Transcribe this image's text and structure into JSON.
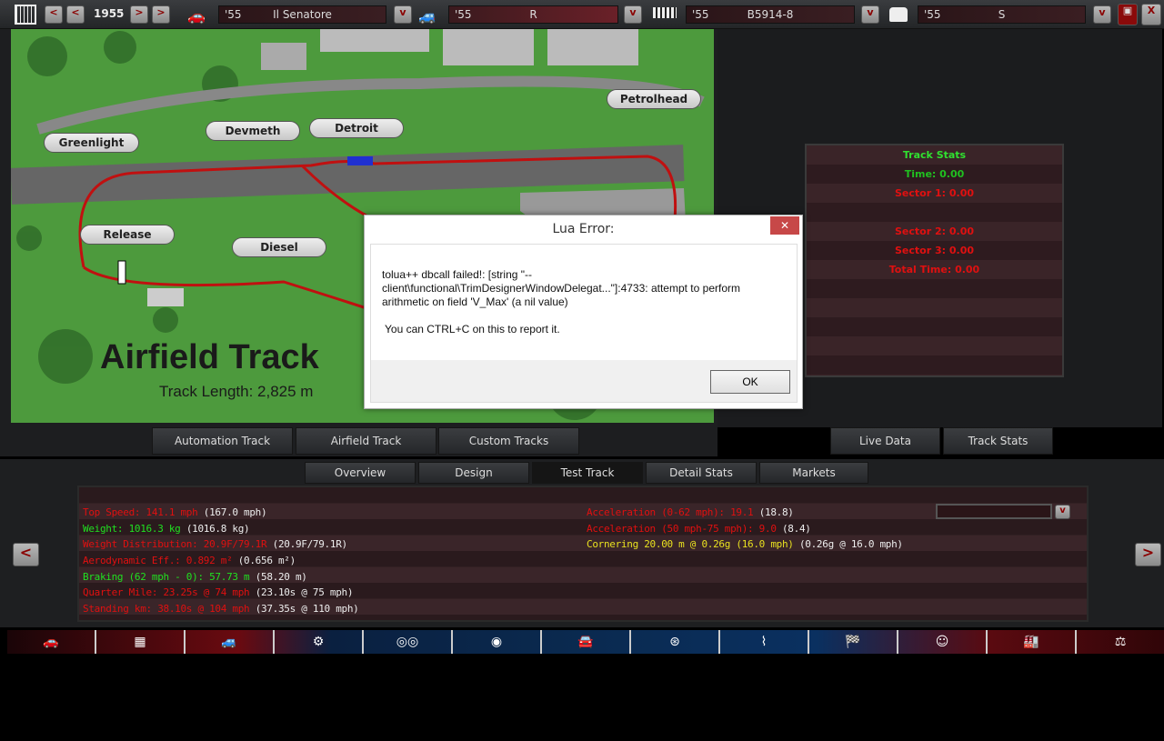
{
  "topbar": {
    "year": "1955",
    "prev_label": "<",
    "next_label": ">",
    "dropdown_label": "v",
    "selectors": [
      {
        "year": "'55",
        "name": "Il Senatore",
        "icon": "car-body-icon"
      },
      {
        "year": "'55",
        "name": "R",
        "icon": "car-trim-icon"
      },
      {
        "year": "'55",
        "name": "B5914-8",
        "icon": "engine-icon"
      },
      {
        "year": "'55",
        "name": "S",
        "icon": "engine-variant-icon"
      }
    ],
    "close_label": "X"
  },
  "map": {
    "title": "Airfield Track",
    "track_length": "Track Length: 2,825 m",
    "markers": [
      "Greenlight",
      "Devmeth",
      "Detroit",
      "Petrolhead",
      "Release",
      "Diesel"
    ],
    "tabs": [
      "Automation Track",
      "Airfield Track",
      "Custom Tracks"
    ]
  },
  "track_stats": {
    "title": "Track Stats",
    "time": "Time: 0.00",
    "sector1": "Sector 1: 0.00",
    "sector2": "Sector 2: 0.00",
    "sector3": "Sector 3: 0.00",
    "total": "Total Time: 0.00",
    "tabs": [
      "Live Data",
      "Track Stats"
    ]
  },
  "main_tabs": [
    "Overview",
    "Design",
    "Test Track",
    "Detail Stats",
    "Markets"
  ],
  "active_tab": "Test Track",
  "stats_left": [
    {
      "label": "Top Speed: 141.1 mph",
      "ref": "(167.0 mph)",
      "color": "red"
    },
    {
      "label": "Weight: 1016.3 kg",
      "ref": "(1016.8 kg)",
      "color": "green"
    },
    {
      "label": "Weight Distribution: 20.9F/79.1R",
      "ref": "(20.9F/79.1R)",
      "color": "red"
    },
    {
      "label": "Aerodynamic Eff.: 0.892 m²",
      "ref": "(0.656 m²)",
      "color": "red"
    },
    {
      "label": "Braking (62 mph - 0): 57.73 m",
      "ref": "(58.20 m)",
      "color": "green"
    },
    {
      "label": "Quarter Mile: 23.25s @ 74 mph",
      "ref": "(23.10s @ 75 mph)",
      "color": "red"
    },
    {
      "label": "Standing km: 38.10s @ 104 mph",
      "ref": "(37.35s @ 110 mph)",
      "color": "red"
    }
  ],
  "stats_right": [
    {
      "label": "Acceleration (0-62 mph): 19.1",
      "ref": "(18.8)",
      "color": "red"
    },
    {
      "label": "Acceleration (50 mph-75 mph): 9.0",
      "ref": "(8.4)",
      "color": "red"
    },
    {
      "label": "Cornering 20.00 m @ 0.26g (16.0 mph)",
      "ref": "(0.26g @ 16.0 mph)",
      "color": "yellow"
    }
  ],
  "nav_left": "<",
  "nav_right": ">",
  "icon_bar": [
    "car-body-icon",
    "chassis-icon",
    "trim-icon",
    "gearbox-icon",
    "wheels-icon",
    "brakes-icon",
    "aero-icon",
    "interior-icon",
    "suspension-icon",
    "test-track-icon",
    "market-icon",
    "factory-icon",
    "balance-icon"
  ],
  "dialog": {
    "title": "Lua Error:",
    "message": "tolua++ dbcall failed!: [string \"--client\\functional\\TrimDesignerWindowDelegat...\"]:4733: attempt to perform arithmetic on field 'V_Max' (a nil value)",
    "hint": "You can CTRL+C on this to report it.",
    "ok_label": "OK",
    "close_label": "✕"
  }
}
